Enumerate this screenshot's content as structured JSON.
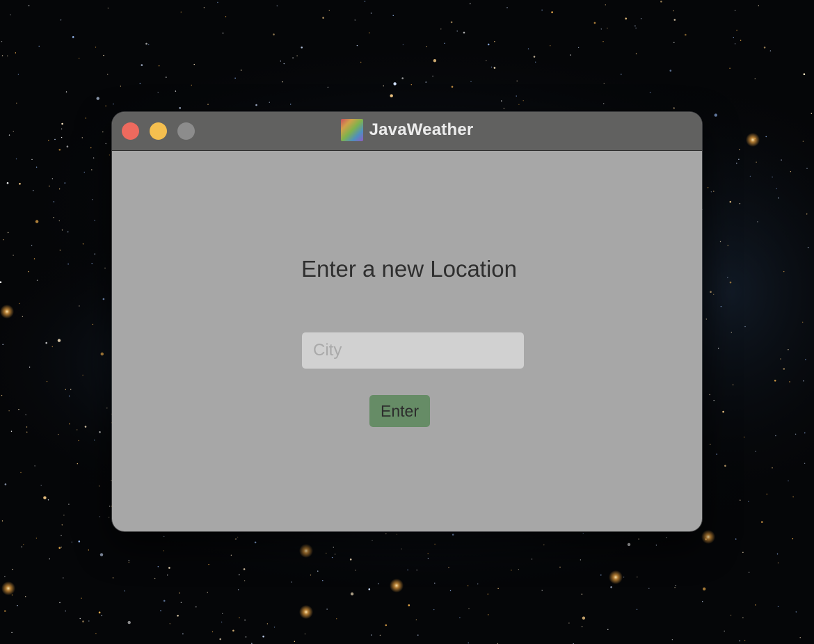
{
  "window": {
    "title": "JavaWeather",
    "app_icon": "app-icon",
    "controls": [
      {
        "name": "close",
        "color": "#ed6a5e"
      },
      {
        "name": "minimize",
        "color": "#f5bf4f"
      },
      {
        "name": "zoom",
        "color": "#8c8c8c"
      }
    ]
  },
  "location_form": {
    "heading": "Enter a new Location",
    "city_input": {
      "placeholder": "City",
      "value": ""
    },
    "submit_label": "Enter"
  },
  "colors": {
    "titlebar": "#616160",
    "window_body": "#a7a7a7",
    "input_background": "#d1d1d1",
    "button_background": "#668c66"
  }
}
